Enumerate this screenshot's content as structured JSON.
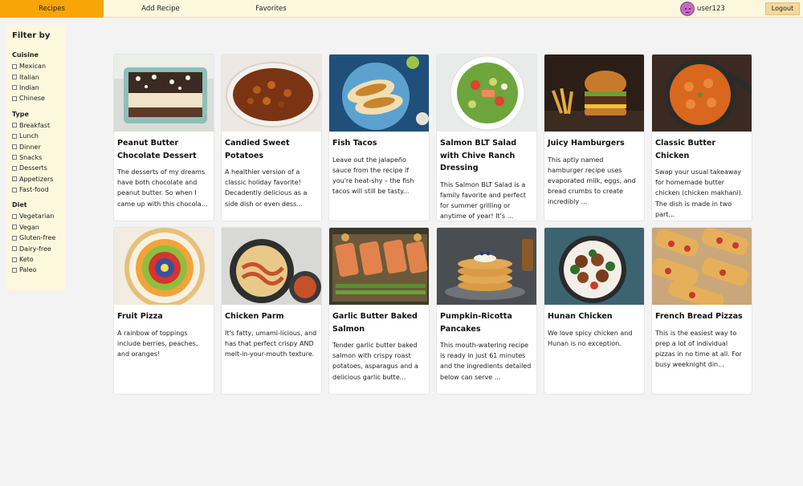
{
  "nav": {
    "tabs": [
      {
        "label": "Recipes",
        "active": true
      },
      {
        "label": "Add Recipe",
        "active": false
      },
      {
        "label": "Favorites",
        "active": false
      }
    ],
    "username": "user123",
    "logout_label": "Logout",
    "accent": "#f6a609"
  },
  "sidebar": {
    "title": "Filter by",
    "groups": [
      {
        "title": "Cuisine",
        "options": [
          "Mexican",
          "Italian",
          "Indian",
          "Chinese"
        ]
      },
      {
        "title": "Type",
        "options": [
          "Breakfast",
          "Lunch",
          "Dinner",
          "Snacks",
          "Desserts",
          "Appetizers",
          "Fast-food"
        ]
      },
      {
        "title": "Diet",
        "options": [
          "Vegetarian",
          "Vegan",
          "Gluten-free",
          "Dairy-free",
          "Keto",
          "Paleo"
        ]
      }
    ]
  },
  "recipes": [
    {
      "title": "Peanut Butter Chocolate Dessert",
      "description": "The desserts of my dreams have both chocolate and peanut butter. So when I came up with this chocola...",
      "image": "dessert-dish-photo"
    },
    {
      "title": "Candied Sweet Potatoes",
      "description": "A healthier version of a classic holiday favorite! Decadently delicious as a side dish or even dess...",
      "image": "sweet-potatoes-photo"
    },
    {
      "title": "Fish Tacos",
      "description": "Leave out the jalapeño sauce from the recipe if you're heat-shy – the fish tacos will still be tasty...",
      "image": "fish-tacos-photo"
    },
    {
      "title": "Salmon BLT Salad with Chive Ranch Dressing",
      "description": "This Salmon BLT Salad is a family favorite and perfect for summer grilling or anytime of year! It's ...",
      "image": "salad-photo"
    },
    {
      "title": "Juicy Hamburgers",
      "description": "This aptly named hamburger recipe uses evaporated milk, eggs, and bread crumbs to create incredibly ...",
      "image": "hamburger-photo"
    },
    {
      "title": "Classic Butter Chicken",
      "description": "Swap your usual takeaway for homemade butter chicken (chicken makhani). The dish is made in two part...",
      "image": "butter-chicken-photo"
    },
    {
      "title": "Fruit Pizza",
      "description": "A rainbow of toppings include berries, peaches, and oranges!",
      "image": "fruit-pizza-photo"
    },
    {
      "title": "Chicken Parm",
      "description": "It's fatty, umami-licious, and has that perfect crispy AND melt-in-your-mouth texture.",
      "image": "chicken-parm-photo"
    },
    {
      "title": "Garlic Butter Baked Salmon",
      "description": "Tender garlic butter baked salmon with crispy roast potatoes, asparagus and a delicious garlic butte...",
      "image": "baked-salmon-photo"
    },
    {
      "title": "Pumpkin-Ricotta Pancakes",
      "description": "This mouth-watering recipe is ready in just 61 minutes and the ingredients detailed below can serve ...",
      "image": "pancakes-photo"
    },
    {
      "title": "Hunan Chicken",
      "description": "We love spicy chicken and Hunan is no exception.",
      "image": "hunan-chicken-photo"
    },
    {
      "title": "French Bread Pizzas",
      "description": "This is the easiest way to prep a lot of individual pizzas in no time at all. For busy weeknight din...",
      "image": "bread-pizzas-photo"
    }
  ]
}
